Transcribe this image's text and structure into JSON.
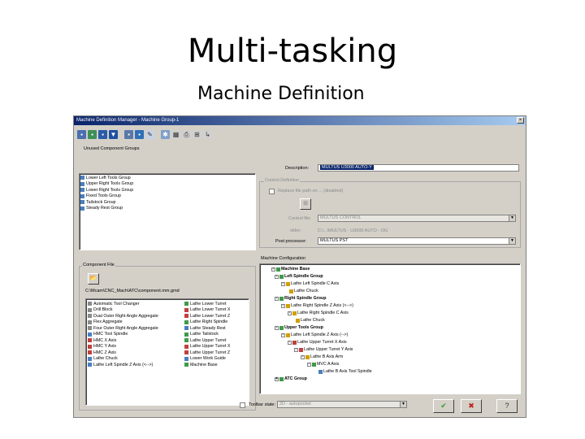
{
  "slide": {
    "title": "Multi-tasking",
    "subtitle": "Machine Definition"
  },
  "window": {
    "title": "Machine Definition Manager - Machine Group-1",
    "close_glyph": "×"
  },
  "toolbar_icons": [
    "new-icon",
    "open-icon",
    "save-icon",
    "down-arrow-icon",
    "folder-icon",
    "save-as-icon",
    "edit-icon",
    "settings-icon",
    "grid-icon",
    "print-icon",
    "tree-icon",
    "chart-icon"
  ],
  "unused_groups": {
    "label": "Unused Component Groups",
    "items": [
      "Lower Left Tools Group",
      "Upper Right Tools Group",
      "Lower Right Tools Group",
      "Fixed Tools Group",
      "Tailstock Group",
      "Steady Rest Group"
    ]
  },
  "description": {
    "label": "Description:",
    "value": "MULTUS U3000 AUTO-Y"
  },
  "control_def": {
    "label": "Control Definition",
    "checkbox_label": "Replace file path on ... (disabled)",
    "control_file_label": "Control file:",
    "control_file_value": "MULTUS CONTROL",
    "folder_label": "older:",
    "folder_value": "C:\\...\\MULTUS - U3000 AUTO - OG",
    "post_label": "Post processor:",
    "post_value": "MULTUS PST"
  },
  "component_file": {
    "label": "Component File",
    "path": "C:\\Mcam\\CNC_Mach\\ATC\\component.mm.gmd",
    "left_items": [
      "Automatic Tool Changer",
      "Drill Block",
      "Dual Outer Right Angle Aggregate",
      "Flex Aggregate",
      "Four Outer Right Angle Aggregate",
      "HMC Tool Spindle",
      "HMC X Axis",
      "HMC Y Axis",
      "HMC Z Axis",
      "Lathe Chuck",
      "Lathe Left Spindle Z Axis (<-->)"
    ],
    "right_items": [
      "Lathe Lower Turret",
      "Lathe Lower Turret X",
      "Lathe Lower Turret Z",
      "Lathe Right Spindle",
      "Lathe Steady Rest",
      "Lathe Tailstock",
      "Lathe Upper Turret",
      "Lathe Upper Turret X",
      "Lathe Upper Turret Z",
      "Lower Work Guide",
      "Machine Base"
    ]
  },
  "machine_config": {
    "label": "Machine Configuration",
    "tree": [
      {
        "label": "Machine Base",
        "bold": true
      },
      {
        "label": "Left Spindle Group",
        "bold": true
      },
      {
        "label": "Lathe Left Spindle C Axis",
        "bold": false
      },
      {
        "label": "Lathe Chuck",
        "bold": false
      },
      {
        "label": "Right Spindle Group",
        "bold": true
      },
      {
        "label": "Lathe Right Spindle Z Axis (<-->)",
        "bold": false
      },
      {
        "label": "Lathe Right Spindle C Axis",
        "bold": false
      },
      {
        "label": "Lathe Chuck",
        "bold": false
      },
      {
        "label": "Upper Tools Group",
        "bold": true
      },
      {
        "label": "Lathe Left Spindle Z Axis (-->)",
        "bold": false
      },
      {
        "label": "Lathe Upper Turret X Axis",
        "bold": false
      },
      {
        "label": "Lathe Upper Turret Y Axis",
        "bold": false
      },
      {
        "label": "Lathe B Axis Arm",
        "bold": false
      },
      {
        "label": "MVC A Axis",
        "bold": false
      },
      {
        "label": "Lathe B Axis Tool Spindle",
        "bold": false
      },
      {
        "label": "ATC Group",
        "bold": true
      }
    ]
  },
  "bottom": {
    "toolbar_label": "Toolbar state:",
    "toolbar_value": "2D - autopocket",
    "ok_glyph": "✔",
    "cancel_glyph": "✖",
    "help_glyph": "?"
  },
  "colors": {
    "window_bg": "#d4d0c8",
    "title_start": "#0a246a",
    "title_end": "#a6caf0",
    "ok": "#2e9a2e",
    "cancel": "#c02020"
  }
}
